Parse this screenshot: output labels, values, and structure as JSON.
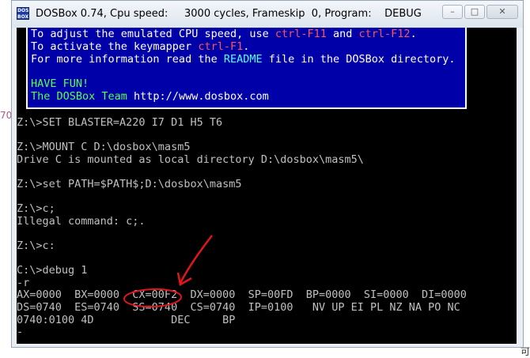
{
  "page": {
    "left_link_fragment": "70",
    "right_fragment": "可"
  },
  "window": {
    "title": "DOSBox 0.74, Cpu speed:     3000 cycles, Frameskip  0, Program:    DEBUG",
    "icon_label": "DOS BOX",
    "controls": {
      "minimize": "–",
      "maximize": "□",
      "close": "✕"
    }
  },
  "banner": {
    "line1": {
      "a": "To adjust the emulated CPU speed, use ",
      "b": "ctrl-F11",
      "c": " and ",
      "d": "ctrl-F12",
      "e": "."
    },
    "line2": {
      "a": "To activate the keymapper ",
      "b": "ctrl-F1",
      "c": "."
    },
    "line3": {
      "a": "For more information read the ",
      "b": "README",
      "c": " file in the DOSBox directory."
    },
    "line4": "HAVE FUN!",
    "line5": {
      "a": "The DOSBox Team ",
      "b": "http://www.dosbox.com"
    }
  },
  "terminal": {
    "lines": [
      "Z:\\>SET BLASTER=A220 I7 D1 H5 T6",
      "",
      "Z:\\>MOUNT C D:\\dosbox\\masm5",
      "Drive C is mounted as local directory D:\\dosbox\\masm5\\",
      "",
      "Z:\\>set PATH=$PATH$;D:\\dosbox\\masm5",
      "",
      "Z:\\>c;",
      "Illegal command: c;.",
      "",
      "Z:\\>c:",
      "",
      "C:\\>debug 1",
      "-r",
      "AX=0000  BX=0000  CX=00F2  DX=0000  SP=00FD  BP=0000  SI=0000  DI=0000",
      "DS=0740  ES=0740  SS=0740  CS=0740  IP=0100   NV UP EI PL NZ NA PO NC",
      "0740:0100 4D            DEC     BP",
      "-"
    ]
  },
  "colors": {
    "banner_bg": "#0000a8",
    "terminal_text": "#c0c0c0",
    "annotation": "#e0161b"
  }
}
